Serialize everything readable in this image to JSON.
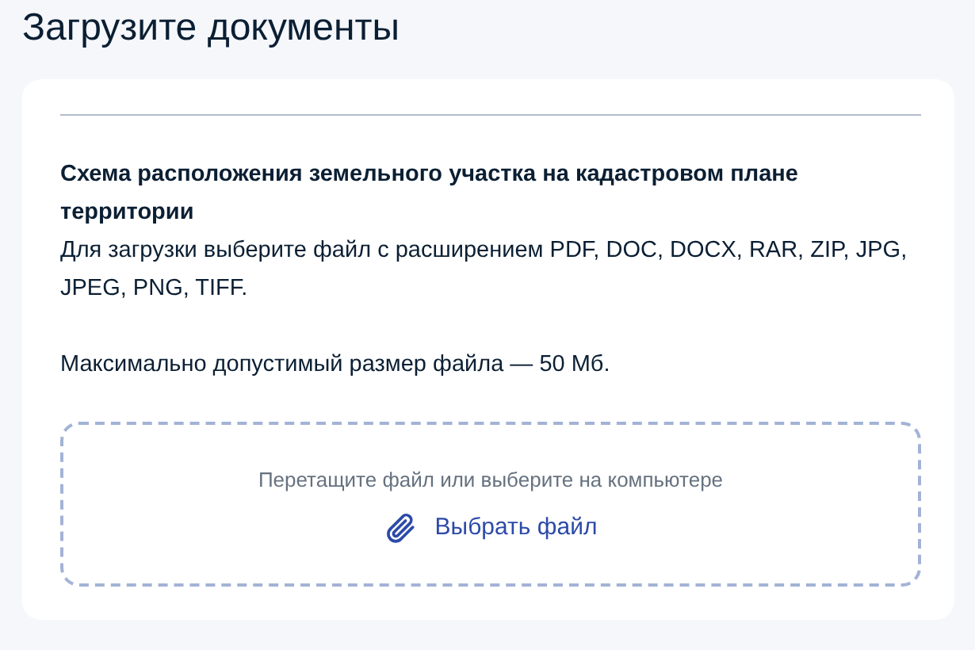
{
  "title": "Загрузите документы",
  "document": {
    "name": "Схема расположения земельного участка на кадастровом плане территории",
    "formats": "Для загрузки выберите файл с расширением PDF, DOC, DOCX, RAR, ZIP, JPG, JPEG, PNG, TIFF.",
    "size_limit": "Максимально допустимый размер файла — 50 Мб."
  },
  "dropzone": {
    "hint": "Перетащите файл или выберите на компьютере",
    "button": "Выбрать файл"
  }
}
